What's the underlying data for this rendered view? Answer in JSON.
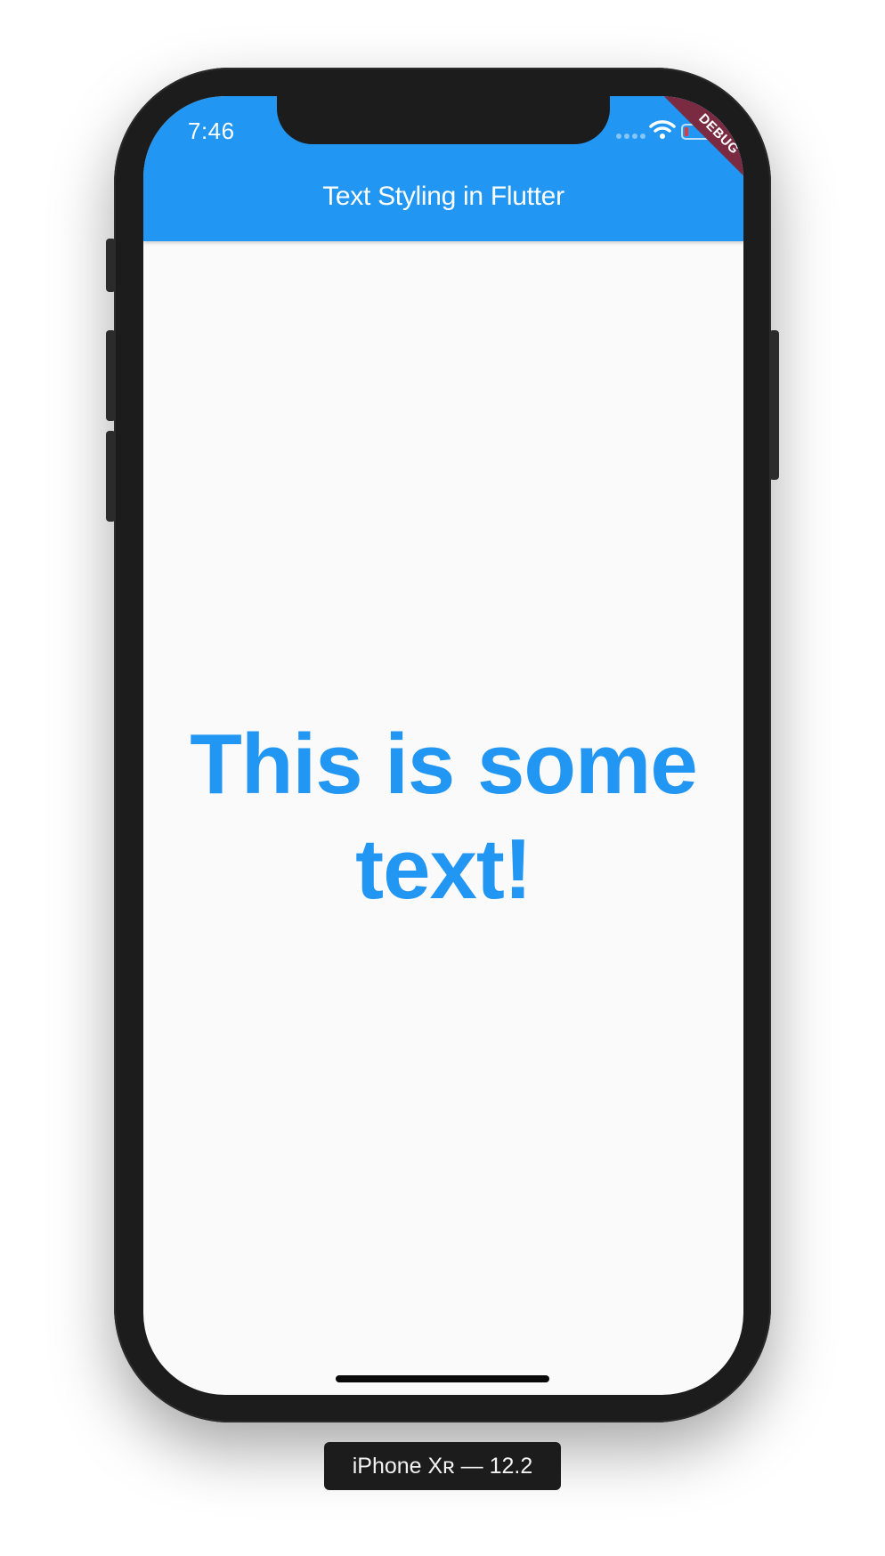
{
  "status_bar": {
    "time": "7:46",
    "icons": [
      "signal-icon",
      "wifi-icon",
      "battery-icon"
    ]
  },
  "app_bar": {
    "title": "Text Styling in Flutter",
    "color": "#2196f3"
  },
  "debug_banner": {
    "label": "DEBUG",
    "color": "#7a2b41"
  },
  "main": {
    "text": "This is some text!",
    "text_color": "#2196f3",
    "background": "#fafafa"
  },
  "simulator": {
    "device_label": "iPhone Xʀ — 12.2"
  }
}
